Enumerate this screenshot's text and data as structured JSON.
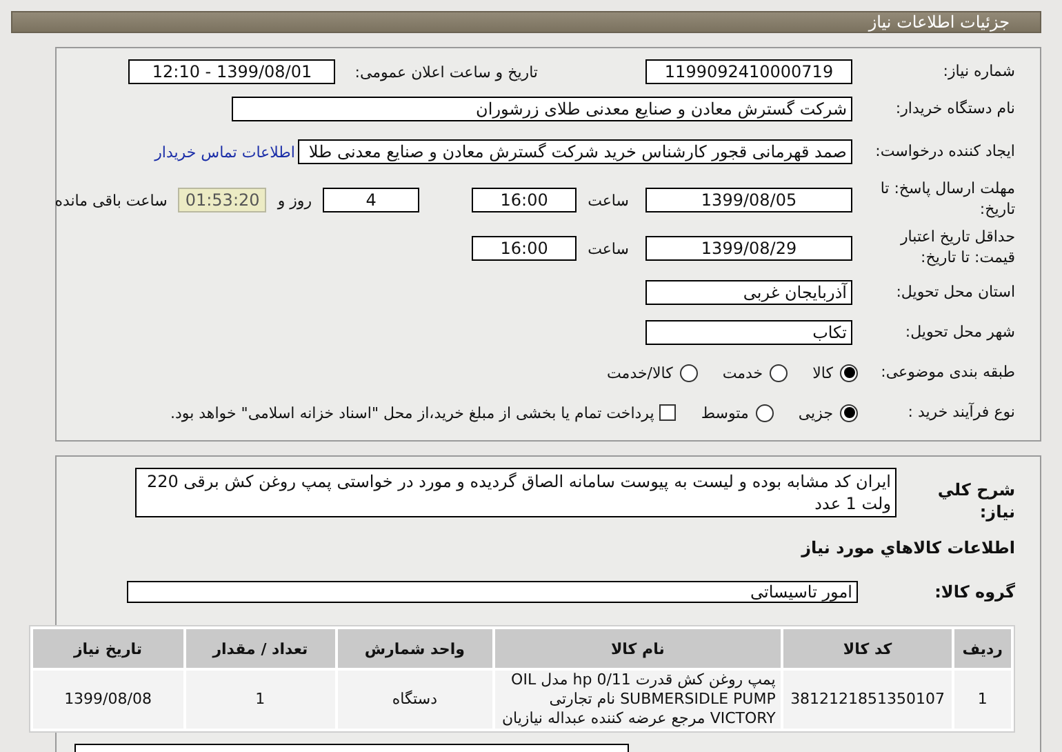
{
  "header": {
    "title": "جزئیات اطلاعات نیاز"
  },
  "need_number": {
    "label": "شماره نیاز:",
    "value": "1199092410000719"
  },
  "announce": {
    "label": "تاریخ و ساعت اعلان عمومی:",
    "value": "1399/08/01 - 12:10"
  },
  "buyer": {
    "label": "نام دستگاه خریدار:",
    "value": "شرکت گسترش معادن و صنایع معدنی طلای زرشوران"
  },
  "creator": {
    "label": "ایجاد کننده درخواست:",
    "value": "صمد قهرمانی قجور کارشناس خرید شرکت گسترش معادن و صنایع معدنی طلا",
    "link": "اطلاعات تماس خریدار"
  },
  "deadline": {
    "label": "مهلت ارسال پاسخ: تا تاریخ:",
    "date": "1399/08/05",
    "time_label": "ساعت",
    "time": "16:00",
    "days": "4",
    "days_label": "روز و",
    "remaining": "01:53:20",
    "remaining_label": "ساعت باقی مانده"
  },
  "validity": {
    "label": "حداقل تاریخ اعتبار قیمت: تا تاریخ:",
    "date": "1399/08/29",
    "time_label": "ساعت",
    "time": "16:00"
  },
  "province": {
    "label": "استان محل تحویل:",
    "value": "آذربایجان غربی"
  },
  "city": {
    "label": "شهر محل تحویل:",
    "value": "تکاب"
  },
  "category": {
    "label": "طبقه بندی موضوعی:",
    "options": [
      {
        "label": "کالا",
        "selected": true
      },
      {
        "label": "خدمت",
        "selected": false
      },
      {
        "label": "کالا/خدمت",
        "selected": false
      }
    ]
  },
  "process": {
    "label": "نوع فرآیند خرید :",
    "options": [
      {
        "label": "جزیی",
        "selected": true
      },
      {
        "label": "متوسط",
        "selected": false
      }
    ],
    "treasury": {
      "label": "پرداخت تمام یا بخشی از مبلغ خرید،از محل \"اسناد خزانه اسلامی\" خواهد بود.",
      "checked": false
    }
  },
  "description": {
    "label": "شرح کلي نياز:",
    "value": "ایران کد مشابه بوده و لیست به پیوست سامانه الصاق گردیده و مورد در خواستی پمپ روغن کش برقی 220 ولت 1 عدد"
  },
  "goods_heading": "اطلاعات کالاهاي مورد نياز",
  "goods_group": {
    "label": "گروه کالا:",
    "value": "امور تاسیساتی"
  },
  "table": {
    "columns": [
      "ردیف",
      "کد کالا",
      "نام کالا",
      "واحد شمارش",
      "تعداد / مقدار",
      "تاریخ نیاز"
    ],
    "rows": [
      [
        "1",
        "3812121851350107",
        "پمپ روغن کش قدرت 0/11 hp مدل OIL SUBMERSIDLE PUMP نام تجارتی VICTORY مرجع عرضه کننده عبداله نیازیان",
        "دستگاه",
        "1",
        "1399/08/08"
      ]
    ]
  }
}
